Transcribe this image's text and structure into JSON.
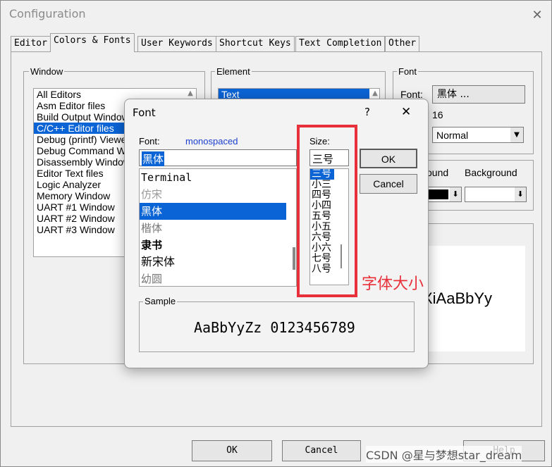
{
  "config": {
    "title": "Configuration",
    "close_glyph": "✕",
    "tabs": [
      "Editor",
      "Colors & Fonts",
      "User Keywords",
      "Shortcut Keys",
      "Text Completion",
      "Other"
    ],
    "selected_tab": 1,
    "window_group": "Window",
    "element_group": "Element",
    "font_group": "Font",
    "windows": [
      "All Editors",
      "Asm Editor files",
      "Build Output Window",
      "C/C++ Editor files",
      "Debug (printf) Viewer",
      "Debug Command Win",
      "Disassembly Window",
      "Editor Text files",
      "Logic Analyzer",
      "Memory Window",
      "UART #1 Window",
      "UART #2 Window",
      "UART #3 Window"
    ],
    "selected_window": 3,
    "element_first": "Text",
    "font_label": "Font:",
    "font_value": "黑体 ...",
    "size_value": "16",
    "style_value": "Normal",
    "foreground_label": "ound",
    "background_label": "Background",
    "sample_text": "XiAaBbYy",
    "ok": "OK",
    "cancel": "Cancel",
    "help": "Help"
  },
  "font_dialog": {
    "title": "Font",
    "help_glyph": "?",
    "close_glyph": "✕",
    "font_label": "Font:",
    "font_hint": "monospaced",
    "font_input": "黑体",
    "fonts": [
      "Terminal",
      "仿宋",
      "黑体",
      "楷体",
      "隶书",
      "新宋体",
      "幼圆"
    ],
    "selected_font": 2,
    "size_label": "Size:",
    "size_input": "三号",
    "sizes": [
      "三号",
      "小三",
      "四号",
      "小四",
      "五号",
      "小五",
      "六号",
      "小六",
      "七号",
      "八号"
    ],
    "selected_size": 0,
    "ok": "OK",
    "cancel": "Cancel",
    "sample_group": "Sample",
    "sample_text": "AaBbYyZz 0123456789"
  },
  "annotation": {
    "label": "字体大小",
    "color": "#e8303a"
  },
  "watermark": "CSDN @星与梦想star_dream"
}
